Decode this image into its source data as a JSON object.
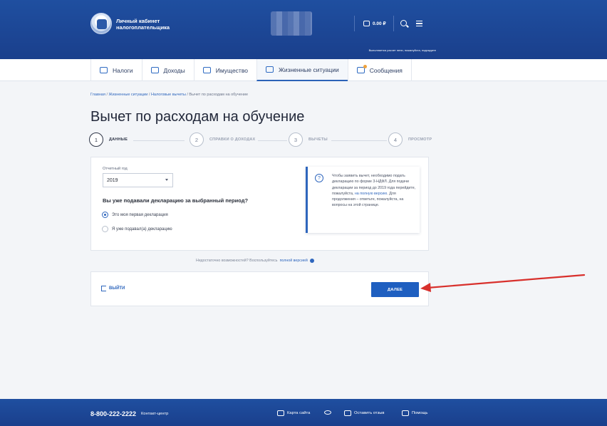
{
  "header": {
    "brand_line1": "Личный кабинет",
    "brand_line2": "налогоплательщика",
    "balance": "0.00 ₽",
    "note": "Выполняется расчет пени, пожалуйста, подождите"
  },
  "nav": {
    "tabs": [
      {
        "label": "Налоги",
        "icon": "tax-icon"
      },
      {
        "label": "Доходы",
        "icon": "income-icon"
      },
      {
        "label": "Имущество",
        "icon": "property-icon"
      },
      {
        "label": "Жизненные ситуации",
        "icon": "life-situations-icon",
        "active": true
      },
      {
        "label": "Сообщения",
        "icon": "messages-icon"
      }
    ]
  },
  "breadcrumb": {
    "items": [
      "Главная",
      "Жизненные ситуации",
      "Налоговые вычеты"
    ],
    "current": "Вычет по расходам на обучение"
  },
  "page_title": "Вычет по расходам на обучение",
  "stepper": {
    "steps": [
      {
        "num": "1",
        "label": "ДАННЫЕ",
        "active": true
      },
      {
        "num": "2",
        "label": "СПРАВКИ О ДОХОДАХ"
      },
      {
        "num": "3",
        "label": "ВЫЧЕТЫ"
      },
      {
        "num": "4",
        "label": "ПРОСМОТР"
      }
    ]
  },
  "form": {
    "year_label": "Отчетный год",
    "year_value": "2019",
    "question": "Вы уже подавали декларацию за выбранный период?",
    "options": [
      {
        "label": "Это моя первая декларация",
        "checked": true
      },
      {
        "label": "Я уже подавал(а) декларацию",
        "checked": false
      }
    ],
    "info_text_1": "Чтобы заявить вычет, необходимо подать декларацию по форме 3-НДФЛ. Для подачи декларации за период до 2019 года перейдите, пожалуйста,",
    "info_link": "на полную версию",
    "info_text_2": ". Для продолжения – ответьте, пожалуйста, на вопросы на этой странице."
  },
  "hint": {
    "text": "Недостаточно возможностей? Воспользуйтесь",
    "link": "полной версией"
  },
  "actions": {
    "exit_label": "ВЫЙТИ",
    "next_label": "ДАЛЕЕ"
  },
  "footer": {
    "phone": "8-800-222-2222",
    "contact": "Контакт-центр",
    "sitemap": "Карта сайта",
    "feedback": "Оставить отзыв",
    "help": "Помощь"
  },
  "colors": {
    "header_blue": "#1f4fa0",
    "accent": "#1f5fc0",
    "annotation_arrow": "#d8302c"
  }
}
